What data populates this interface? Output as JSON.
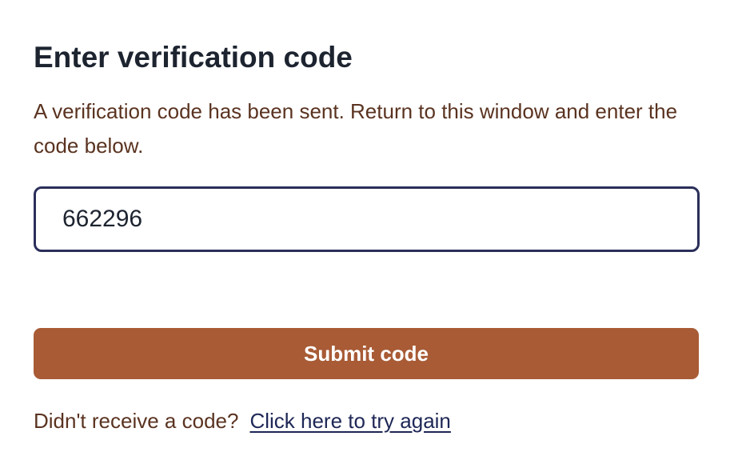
{
  "page": {
    "title": "Enter verification code",
    "description": "A verification code has been sent. Return to this window and enter the code below."
  },
  "code_field": {
    "value": "662296"
  },
  "submit": {
    "label": "Submit code"
  },
  "retry": {
    "prompt": "Didn't receive a code?",
    "link_label": "Click here to try again"
  },
  "colors": {
    "title": "#1d2430",
    "body_text": "#5a3320",
    "input_border": "#2b2f5a",
    "button_bg": "#a85b35",
    "button_text": "#ffffff",
    "link": "#1e2756"
  }
}
